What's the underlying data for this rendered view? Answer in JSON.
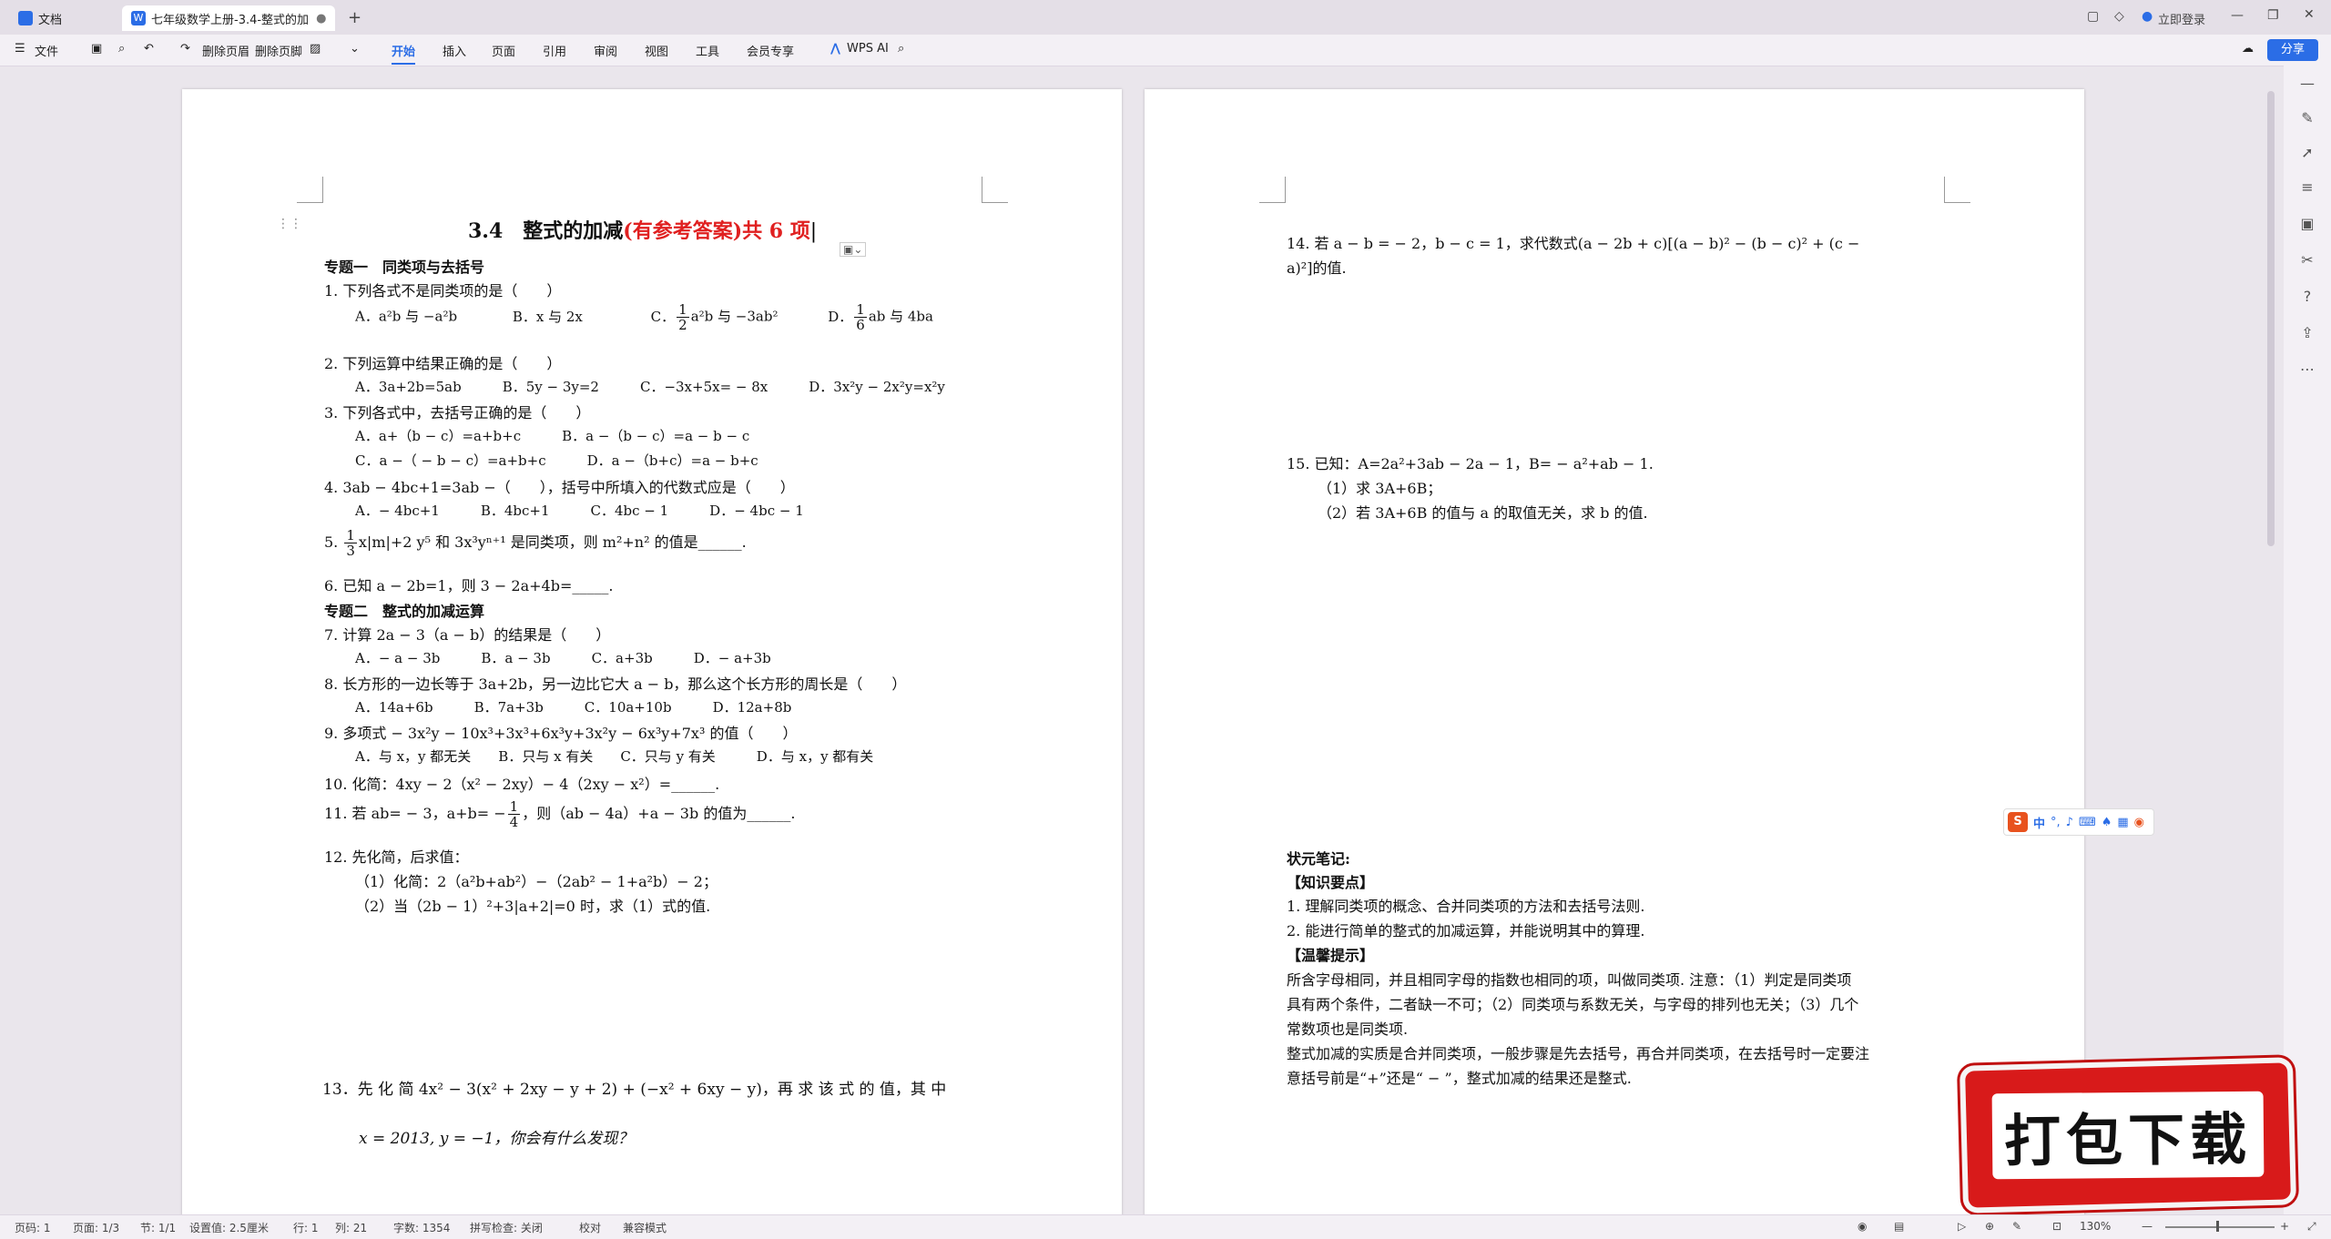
{
  "titlebar": {
    "tab_docs": "文档",
    "tab_doc": "七年级数学上册-3.4-整式的加",
    "login": "立即登录"
  },
  "toolbar": {
    "file": "文件",
    "delete_header": "删除页眉",
    "delete_footer": "删除页脚",
    "tabs": [
      "开始",
      "插入",
      "页面",
      "引用",
      "审阅",
      "视图",
      "工具",
      "会员专享"
    ],
    "wps_ai": "WPS AI",
    "share": "分享"
  },
  "page1": {
    "title_black": "3.4　整式的加减",
    "title_red": "(有参考答案)共 6 项",
    "section1": "专题一　同类项与去括号",
    "q1": "1. 下列各式不是同类项的是（　　）",
    "q1_opts": [
      "A．a²b 与 −a²b",
      "B．x 与 2x",
      "C．",
      "a²b 与 −3ab²",
      "D．",
      "ab 与 4ba"
    ],
    "q2": "2. 下列运算中结果正确的是（　　）",
    "q2_opts": "A．3a+2b=5ab　　　B．5y − 3y=2　　　C．−3x+5x= − 8x　　　D．3x²y − 2x²y=x²y",
    "q3": "3. 下列各式中，去括号正确的是（　　）",
    "q3_a": "A．a+（b − c）=a+b+c　　　B．a −（b − c）=a − b − c",
    "q3_c": "C．a −（ − b − c）=a+b+c　　　D．a −（b+c）=a − b+c",
    "q4": "4. 3ab − 4bc+1=3ab −（　　），括号中所填入的代数式应是（　　）",
    "q4_opts": "A．− 4bc+1　　　B．4bc+1　　　C．4bc − 1　　　D．− 4bc − 1",
    "q5_pre": "5.",
    "q5_post": "x|m|+2 y⁵ 和 3x³yⁿ⁺¹ 是同类项，则 m²+n² 的值是______.",
    "q6": "6. 已知 a − 2b=1，则 3 − 2a+4b=_____.",
    "section2": "专题二　整式的加减运算",
    "q7": "7. 计算 2a − 3（a − b）的结果是（　　）",
    "q7_opts": "A．− a − 3b　　　B．a − 3b　　　C．a+3b　　　D．− a+3b",
    "q8": "8. 长方形的一边长等于 3a+2b，另一边比它大 a − b，那么这个长方形的周长是（　　）",
    "q8_opts": "A．14a+6b　　　B．7a+3b　　　C．10a+10b　　　D．12a+8b",
    "q9": "9. 多项式 − 3x²y − 10x³+3x³+6x³y+3x²y − 6x³y+7x³ 的值（　　）",
    "q9_opts": "A．与 x，y 都无关　　B．只与 x 有关　　C．只与 y 有关　　　D．与 x，y 都有关",
    "q10": "10. 化简：4xy − 2（x² − 2xy）− 4（2xy − x²）=______.",
    "q11_pre": "11. 若 ab= − 3，a+b= −",
    "q11_post": "，则（ab − 4a）+a − 3b 的值为______.",
    "q12": "12. 先化简，后求值：",
    "q12_1": "（1）化简：2（a²b+ab²）−（2ab² − 1+a²b）− 2；",
    "q12_2": "（2）当（2b − 1）²+3|a+2|=0 时，求（1）式的值.",
    "q13": "13．先 化 简  4x² − 3(x² + 2xy − y + 2) + (−x² + 6xy − y)，再 求 该 式 的 值，其 中",
    "q13_b": "x = 2013, y = −1，你会有什么发现？"
  },
  "page2": {
    "q14_a": "14. 若 a − b = − 2，b − c = 1，求代数式(a − 2b + c)[(a − b)² − (b − c)² + (c −",
    "q14_b": "a)²]的值.",
    "q15": "15. 已知：A=2a²+3ab − 2a − 1，B= − a²+ab − 1.",
    "q15_1": "（1）求 3A+6B；",
    "q15_2": "（2）若 3A+6B 的值与 a 的取值无关，求 b 的值.",
    "notes_title": "状元笔记:",
    "knowledge": "【知识要点】",
    "k1": "1. 理解同类项的概念、合并同类项的方法和去括号法则.",
    "k2": "2. 能进行简单的整式的加减运算，并能说明其中的算理.",
    "tips": "【温馨提示】",
    "t1": "所含字母相同，并且相同字母的指数也相同的项，叫做同类项. 注意：（1）判定是同类项",
    "t2": "具有两个条件，二者缺一不可；（2）同类项与系数无关，与字母的排列也无关；（3）几个",
    "t3": "常数项也是同类项.",
    "t4": "整式加减的实质是合并同类项，一般步骤是先去括号，再合并同类项，在去括号时一定要注",
    "t5": "意括号前是“+”还是“ − ”，整式加减的结果还是整式."
  },
  "statusbar": {
    "page": "页码: 1",
    "pages": "页面: 1/3",
    "section": "节: 1/1",
    "setting": "设置值: 2.5厘米",
    "row": "行: 1",
    "col": "列: 21",
    "words": "字数: 1354",
    "spell": "拼写检查: 关闭",
    "proof": "校对",
    "compat": "兼容模式",
    "zoom": "130%"
  },
  "ime": {
    "label": "中"
  },
  "download": "打包下载",
  "colors": {
    "accent": "#2b6de6",
    "title_red": "#e02020",
    "banner_red": "#d81a1a"
  }
}
